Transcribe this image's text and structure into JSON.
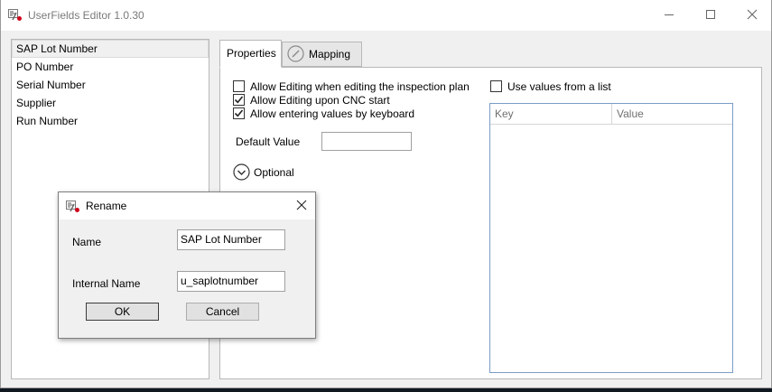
{
  "window": {
    "title": "UserFields Editor 1.0.30"
  },
  "user_fields": {
    "items": [
      {
        "label": "SAP Lot Number",
        "selected": true
      },
      {
        "label": "PO Number",
        "selected": false
      },
      {
        "label": "Serial Number",
        "selected": false
      },
      {
        "label": "Supplier",
        "selected": false
      },
      {
        "label": "Run Number",
        "selected": false
      }
    ]
  },
  "tabs": {
    "properties": "Properties",
    "mapping": "Mapping",
    "active": "Properties"
  },
  "properties": {
    "allow_edit_inspection_plan": {
      "label": "Allow Editing when editing the inspection plan",
      "checked": false
    },
    "allow_edit_cnc_start": {
      "label": "Allow Editing upon CNC start",
      "checked": true
    },
    "allow_keyboard_entry": {
      "label": "Allow entering values by keyboard",
      "checked": true
    },
    "default_value_label": "Default Value",
    "default_value": "",
    "optional_label": "Optional",
    "use_values_list": {
      "label": "Use values from a list",
      "checked": false
    },
    "values_table": {
      "columns": [
        "Key",
        "Value"
      ],
      "rows": []
    }
  },
  "rename_dialog": {
    "title": "Rename",
    "name_label": "Name",
    "name_value": "SAP Lot Number",
    "internal_name_label": "Internal Name",
    "internal_name_value": "u_saplotnumber",
    "ok_label": "OK",
    "cancel_label": "Cancel"
  },
  "colors": {
    "window_bg": "#f0f0f0",
    "titlebar_bg": "#ffffff",
    "table_border": "#7a9cc6",
    "app_icon_accent": "#d0021b"
  },
  "icons": {
    "app": "userfields-app-icon",
    "mapping_tab": "slash-circle-icon",
    "optional_expander": "chevron-down-circle-icon",
    "minimize": "minimize-icon",
    "maximize": "maximize-icon",
    "close": "close-icon"
  }
}
